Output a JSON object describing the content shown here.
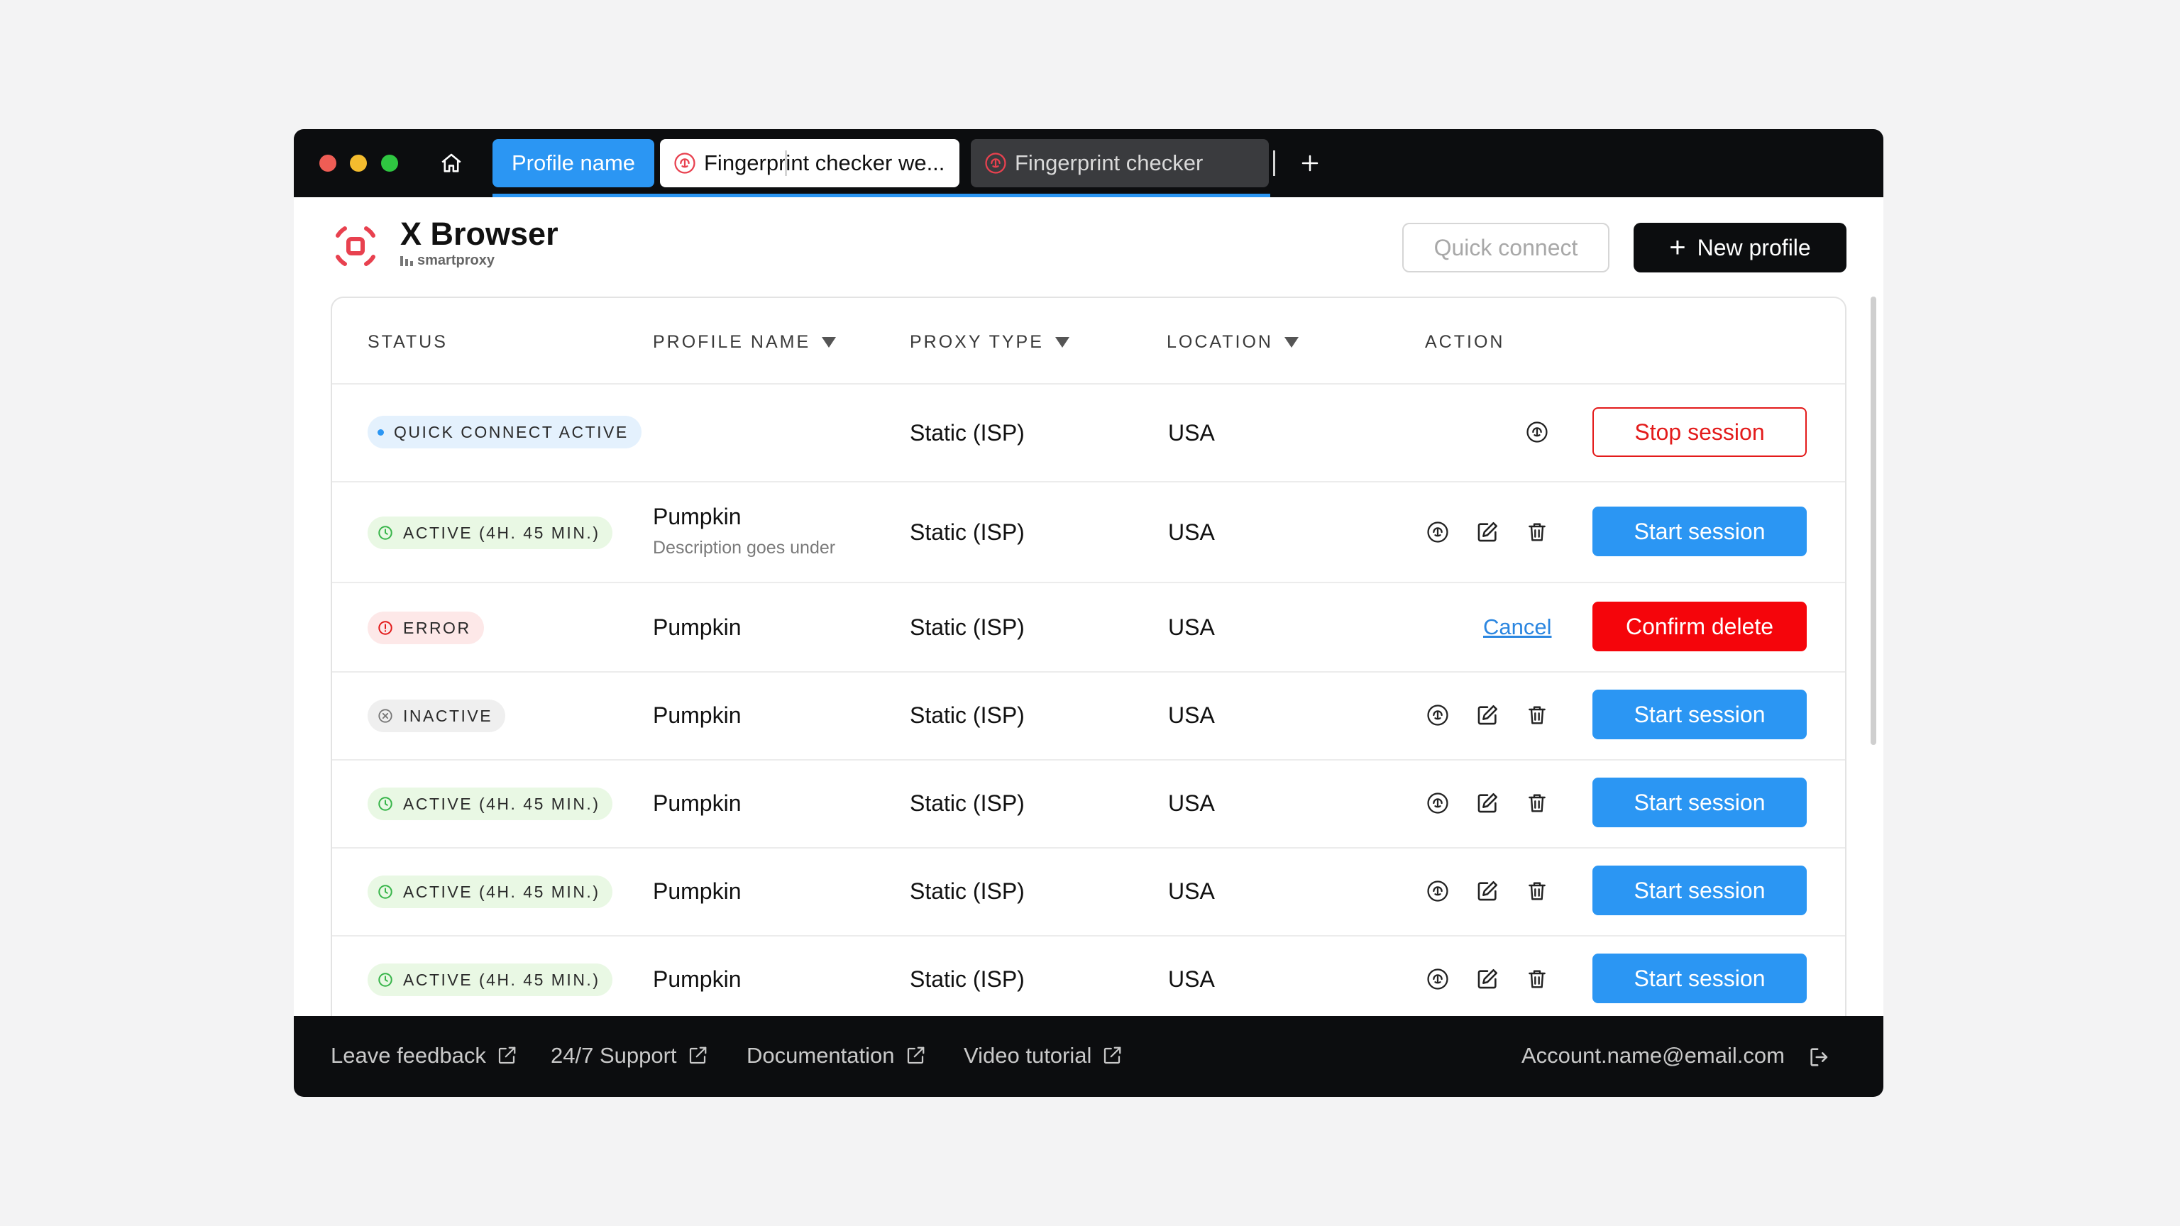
{
  "titlebar": {
    "tabs": [
      {
        "label": "Profile name"
      },
      {
        "label": "Fingerprint checker we..."
      },
      {
        "label": "Fingerprint checker"
      }
    ]
  },
  "header": {
    "brand_title": "X Browser",
    "brand_sub": "smartproxy",
    "quick_connect_label": "Quick connect",
    "new_profile_label": "New profile"
  },
  "table": {
    "headers": {
      "status": "STATUS",
      "profile_name": "PROFILE NAME",
      "proxy_type": "PROXY TYPE",
      "location": "LOCATION",
      "action": "ACTION"
    },
    "rows": [
      {
        "status": "QUICK CONNECT ACTIVE",
        "status_kind": "quick",
        "name": "",
        "description": "",
        "proxy": "Static (ISP)",
        "location": "USA",
        "action_label": "Stop session"
      },
      {
        "status": "ACTIVE (4H. 45 MIN.)",
        "status_kind": "active",
        "name": "Pumpkin",
        "description": "Description goes under",
        "proxy": "Static (ISP)",
        "location": "USA",
        "action_label": "Start session"
      },
      {
        "status": "ERROR",
        "status_kind": "error",
        "name": "Pumpkin",
        "description": "",
        "proxy": "Static (ISP)",
        "location": "USA",
        "cancel_label": "Cancel",
        "action_label": "Confirm delete"
      },
      {
        "status": "INACTIVE",
        "status_kind": "inactive",
        "name": "Pumpkin",
        "description": "",
        "proxy": "Static (ISP)",
        "location": "USA",
        "action_label": "Start session"
      },
      {
        "status": "ACTIVE (4H. 45 MIN.)",
        "status_kind": "active",
        "name": "Pumpkin",
        "description": "",
        "proxy": "Static (ISP)",
        "location": "USA",
        "action_label": "Start session"
      },
      {
        "status": "ACTIVE (4H. 45 MIN.)",
        "status_kind": "active",
        "name": "Pumpkin",
        "description": "",
        "proxy": "Static (ISP)",
        "location": "USA",
        "action_label": "Start session"
      },
      {
        "status": "ACTIVE (4H. 45 MIN.)",
        "status_kind": "active",
        "name": "Pumpkin",
        "description": "",
        "proxy": "Static (ISP)",
        "location": "USA",
        "action_label": "Start session"
      }
    ]
  },
  "footer": {
    "links": [
      {
        "label": "Leave feedback"
      },
      {
        "label": "24/7 Support"
      },
      {
        "label": "Documentation"
      },
      {
        "label": "Video tutorial"
      }
    ],
    "account": "Account.name@email.com"
  },
  "colors": {
    "accent": "#2b96f3",
    "danger": "#f5050b",
    "brand": "#e8414f",
    "dark": "#0c0d0f",
    "success": "#38b54a"
  },
  "icons": {
    "home": "home-icon",
    "tab": "fingerprint-icon",
    "add_tab": "plus-icon",
    "logo": "xbrowser-logo-icon",
    "row_actions": [
      "fingerprint-icon",
      "edit-icon",
      "trash-icon"
    ],
    "footer_link": "external-link-icon",
    "logout": "logout-icon"
  }
}
